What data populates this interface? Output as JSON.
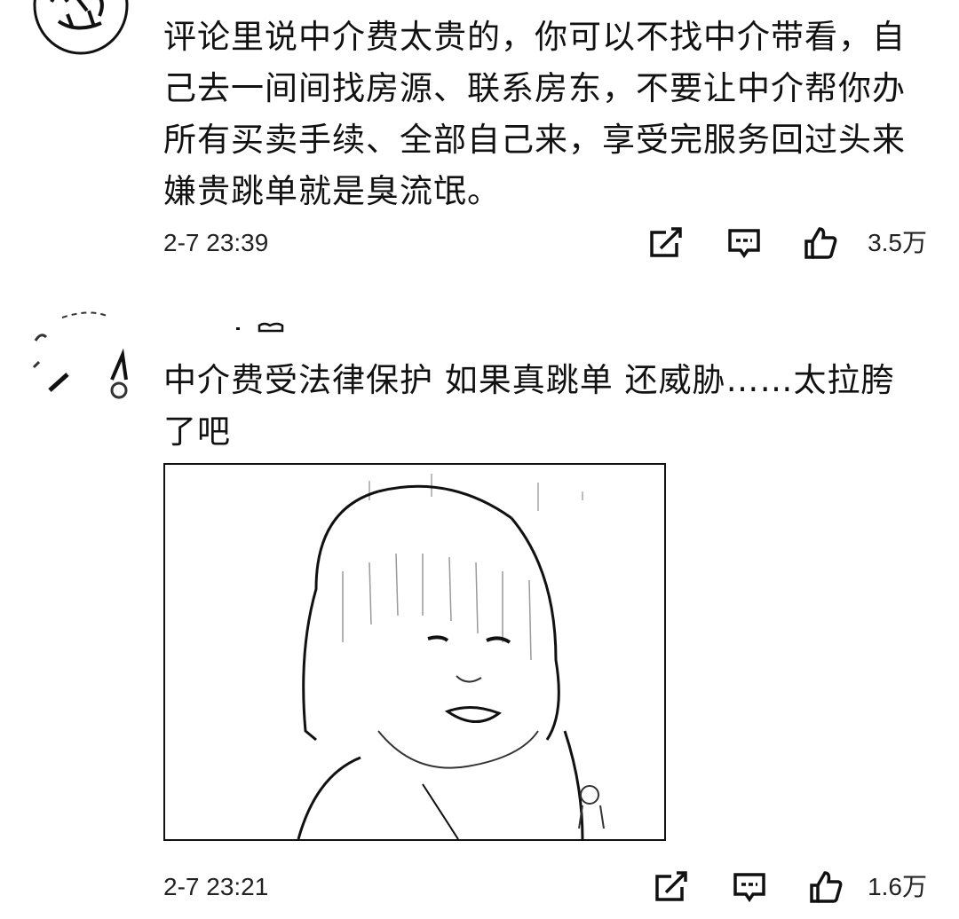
{
  "comments": [
    {
      "text": "评论里说中介费太贵的，你可以不找中介带看，自己去一间间找房源、联系房东，不要让中介帮你办所有买卖手续、全部自己来，享受完服务回过头来嫌贵跳单就是臭流氓。",
      "time": "2-7 23:39",
      "likes": "3.5万"
    },
    {
      "text": "中介费受法律保护 如果真跳单 还威胁……太拉胯了吧",
      "time": "2-7 23:21",
      "likes": "1.6万"
    }
  ],
  "icons": {
    "share": "share-icon",
    "reply": "comment-icon",
    "like": "thumbs-up-icon"
  }
}
